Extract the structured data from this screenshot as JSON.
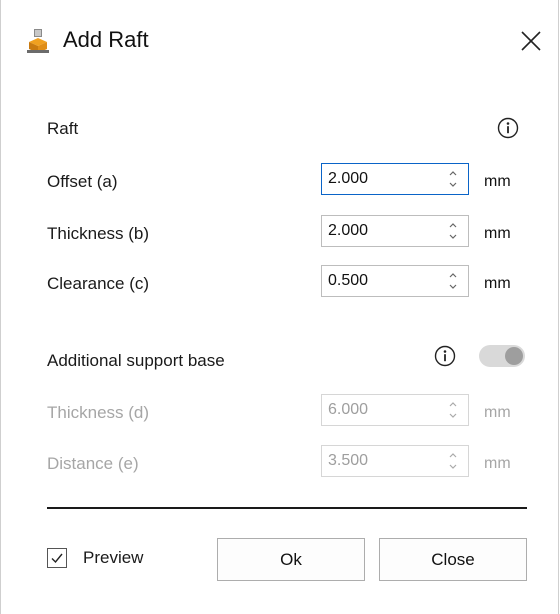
{
  "window": {
    "title": "Add Raft"
  },
  "raft": {
    "heading": "Raft",
    "fields": [
      {
        "label": "Offset (a)",
        "value": "2.000",
        "unit": "mm"
      },
      {
        "label": "Thickness (b)",
        "value": "2.000",
        "unit": "mm"
      },
      {
        "label": "Clearance (c)",
        "value": "0.500",
        "unit": "mm"
      }
    ]
  },
  "support_base": {
    "heading": "Additional support base",
    "enabled": false,
    "fields": [
      {
        "label": "Thickness (d)",
        "value": "6.000",
        "unit": "mm"
      },
      {
        "label": "Distance (e)",
        "value": "3.500",
        "unit": "mm"
      }
    ]
  },
  "footer": {
    "preview_label": "Preview",
    "preview_checked": true,
    "ok_label": "Ok",
    "close_label": "Close"
  },
  "colors": {
    "focus_border": "#0a64c8",
    "disabled_text": "#a6a6a6"
  }
}
